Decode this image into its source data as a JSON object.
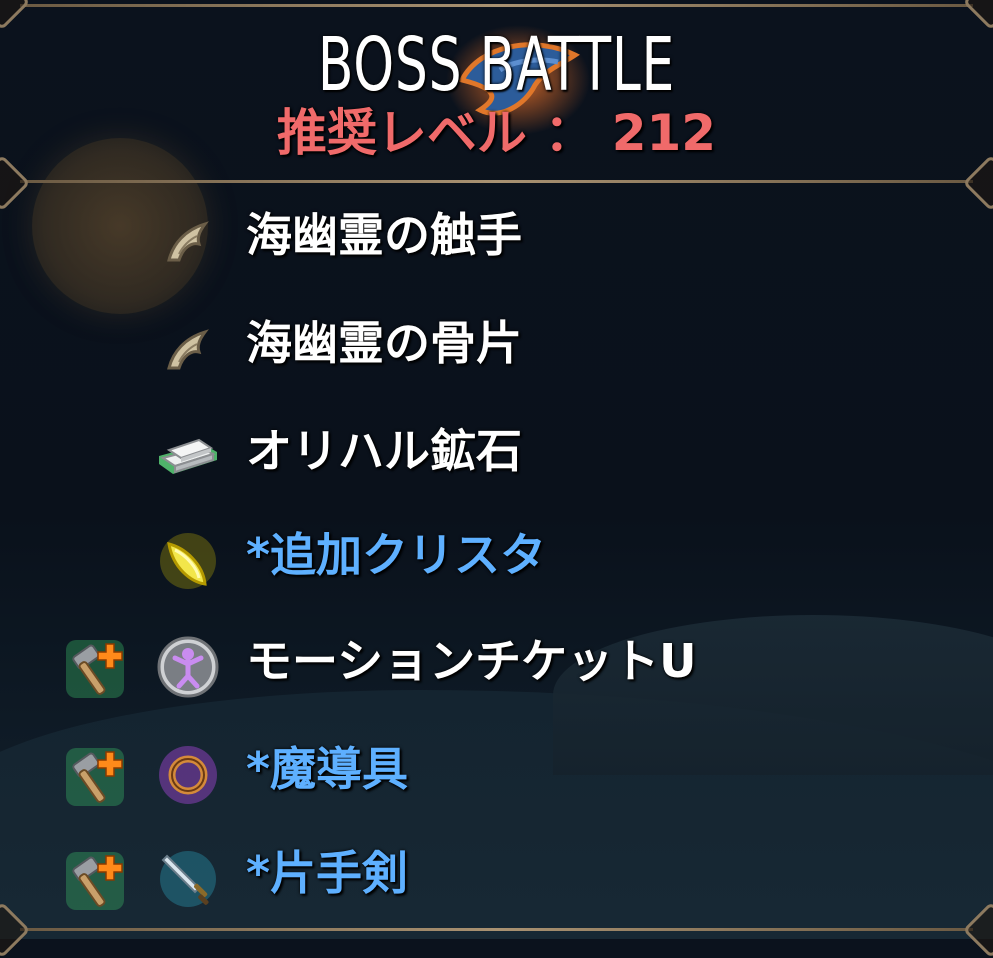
{
  "header": {
    "title": "BOSS  BATTLE",
    "recommended_level": "推奨レベル ： 212"
  },
  "drops": [
    {
      "label": "海幽霊の触手",
      "color": "white",
      "icon": "claw-icon",
      "wrench": false
    },
    {
      "label": "海幽霊の骨片",
      "color": "white",
      "icon": "claw-icon",
      "wrench": false
    },
    {
      "label": "オリハル鉱石",
      "color": "white",
      "icon": "ore-ingot-icon",
      "wrench": false
    },
    {
      "label": "*追加クリスタ",
      "color": "blue",
      "icon": "yellow-crystal-icon",
      "wrench": false
    },
    {
      "label": "モーションチケットU",
      "color": "white",
      "icon": "motion-figure-icon",
      "wrench": true
    },
    {
      "label": "*魔導具",
      "color": "blue",
      "icon": "magic-ring-icon",
      "wrench": true
    },
    {
      "label": "*片手剣",
      "color": "blue",
      "icon": "one-hand-sword-icon",
      "wrench": true
    }
  ],
  "colors": {
    "title": "#ffffff",
    "level": "#f06a6a",
    "item_white": "#ffffff",
    "item_blue": "#5eb0ff",
    "frame": "#a99272"
  }
}
